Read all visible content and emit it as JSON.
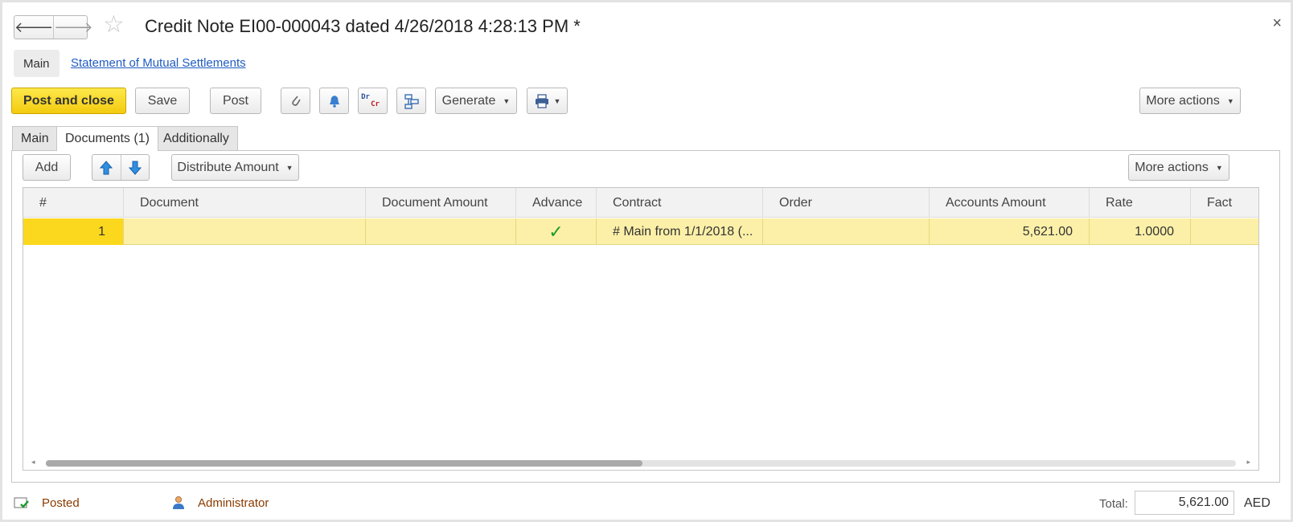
{
  "window": {
    "title": "Credit Note EI00-000043 dated 4/26/2018 4:28:13 PM *",
    "back_symbol": "🡐",
    "forward_symbol": "🡒",
    "star_symbol": "☆",
    "close_symbol": "×"
  },
  "sections": {
    "main": "Main",
    "statement_link": "Statement of Mutual Settlements"
  },
  "toolbar": {
    "post_and_close": "Post and close",
    "save": "Save",
    "post": "Post",
    "generate": "Generate",
    "more_actions": "More actions",
    "dr": "Dr",
    "cr": "Cr",
    "icons": [
      "paperclip-icon",
      "bell-icon",
      "dr-cr-icon",
      "structure-icon",
      "print-icon"
    ]
  },
  "tabs": [
    {
      "label": "Main"
    },
    {
      "label": "Documents (1)"
    },
    {
      "label": "Additionally"
    }
  ],
  "table_toolbar": {
    "add": "Add",
    "distribute_amount": "Distribute Amount",
    "more_actions": "More actions"
  },
  "table": {
    "columns": [
      "#",
      "Document",
      "Document Amount",
      "Advance",
      "Contract",
      "Order",
      "Accounts Amount",
      "Rate",
      "Fact"
    ],
    "rows": [
      {
        "num": "1",
        "document": "",
        "document_amount": "",
        "advance": "✓",
        "contract": "# Main from 1/1/2018 (...",
        "order": "",
        "accounts_amount": "5,621.00",
        "rate": "1.0000",
        "fact": ""
      }
    ],
    "scroll_left": "◂",
    "scroll_right": "▸"
  },
  "footer": {
    "status": "Posted",
    "user": "Administrator",
    "total_label": "Total:",
    "total_value": "5,621.00",
    "currency": "AED"
  },
  "colors": {
    "primary_button": "#f3cb10",
    "selected_row": "#fcf0a8",
    "selected_cell": "#fbd81d",
    "link": "#1f5bc0",
    "footer_text": "#8a3b00",
    "check": "#1a9a2a"
  }
}
